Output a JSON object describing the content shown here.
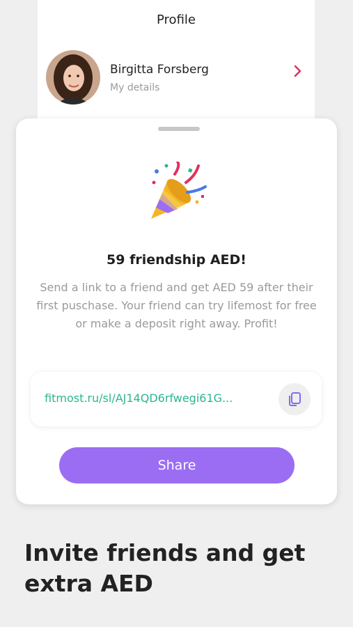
{
  "profile": {
    "title": "Profile",
    "user_name": "Birgitta Forsberg",
    "user_sub": "My details"
  },
  "invite_card": {
    "title": "59 friendship AED!",
    "description": "Send a link to a friend and get AED 59 after their first puschase. Your friend can try lifemost for free or make a deposit right away. Profit!",
    "link": "fitmost.ru/sl/AJ14QD6rfwegi61G...",
    "share_label": "Share"
  },
  "hero": {
    "text": "Invite friends and get extra AED"
  },
  "colors": {
    "accent": "#9b6df3",
    "link": "#2bb68f",
    "chevron": "#e0315f"
  },
  "icons": [
    "party-popper-icon",
    "chevron-right-icon",
    "copy-icon"
  ]
}
